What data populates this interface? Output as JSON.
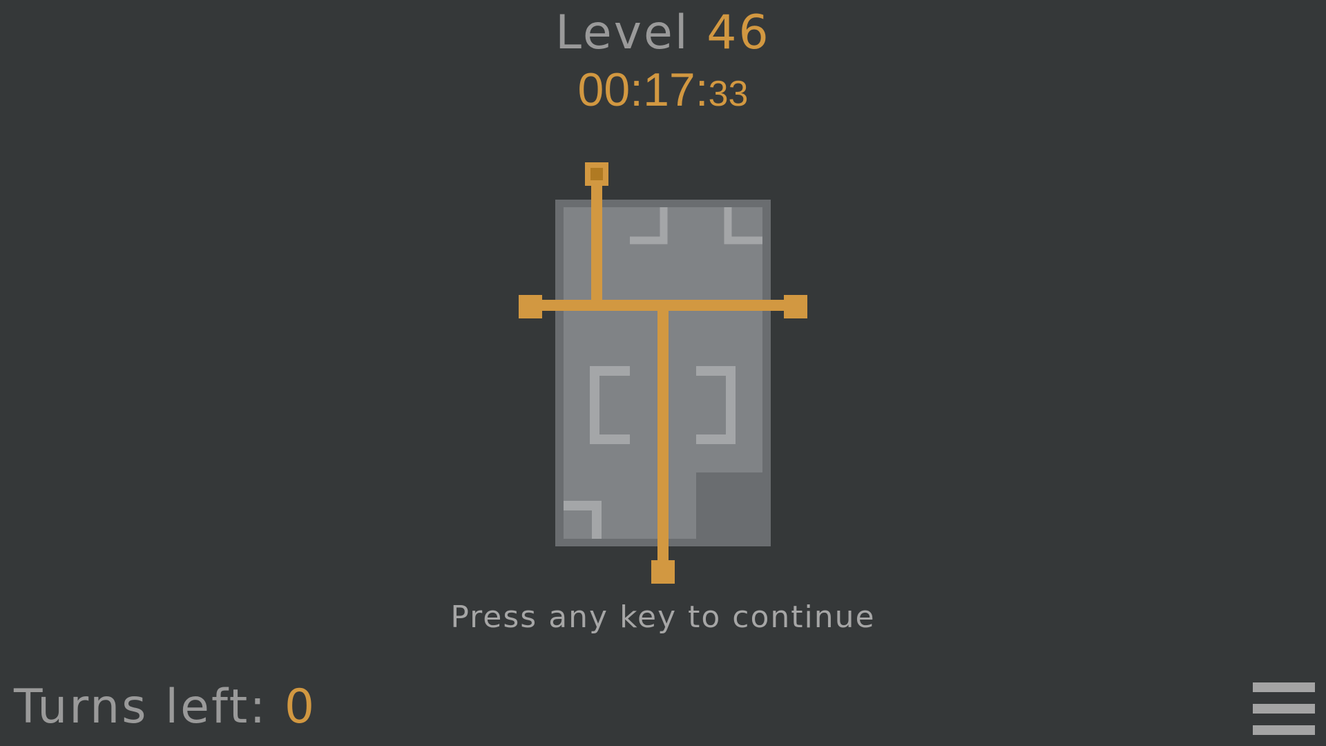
{
  "hud": {
    "level_label": "Level",
    "level_number": "46",
    "timer_main": "00:17:",
    "timer_ms": "33"
  },
  "prompt": {
    "continue_text": "Press any key to continue"
  },
  "status": {
    "turns_label": "Turns left:",
    "turns_value": "0"
  },
  "icons": {
    "menu": "hamburger-menu-icon"
  },
  "colors": {
    "background": "#353839",
    "accent_orange": "#d29841",
    "text_gray": "#9a9a9a",
    "board_frame": "#6a6d70",
    "board_fill": "#808386",
    "bracket": "#a4a6a8",
    "node_center": "#b07a22"
  }
}
